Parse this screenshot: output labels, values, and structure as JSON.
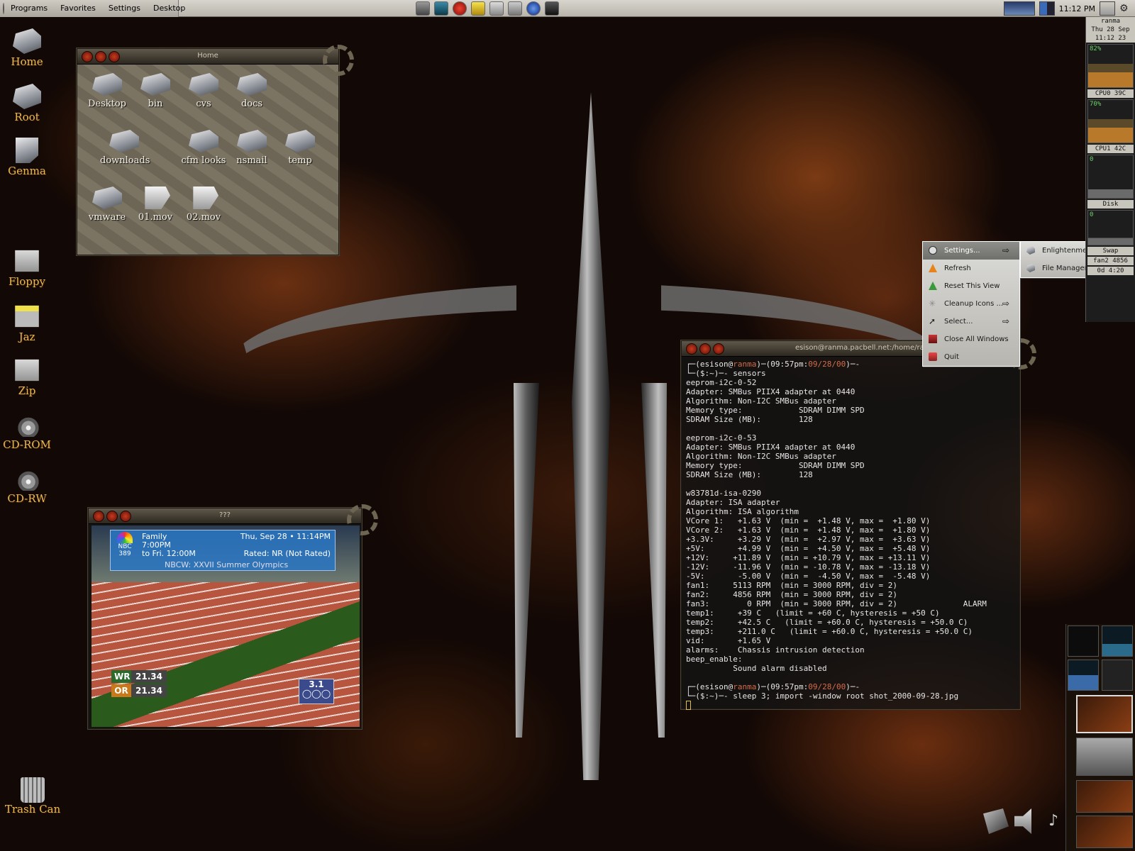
{
  "top_panel": {
    "menus": [
      "Programs",
      "Favorites",
      "Settings",
      "Desktop"
    ],
    "clock": "11:12 PM"
  },
  "desktop_icons": [
    "Home",
    "Root",
    "Genma",
    "Floppy",
    "Jaz",
    "Zip",
    "CD-ROM",
    "CD-RW"
  ],
  "trash_label": "Trash Can",
  "home_window": {
    "title": "Home",
    "files": [
      "Desktop",
      "bin",
      "cvs",
      "docs",
      "downloads",
      "cfm looks",
      "nsmail",
      "temp",
      "vmware",
      "01.mov",
      "02.mov"
    ]
  },
  "video_window": {
    "title": "???",
    "guide": {
      "channel": "NBC",
      "channel_num": "389",
      "genre": "Family",
      "time": "7:00PM",
      "until": "to Fri. 12:00M",
      "date": "Thu, Sep 28 • 11:14PM",
      "rated": "Rated: NR (Not Rated)",
      "show": "NBCW: XXVII Summer Olympics"
    },
    "scores": [
      {
        "tag": "WR",
        "value": "21.34"
      },
      {
        "tag": "OR",
        "value": "21.34"
      }
    ],
    "heat": "3.1"
  },
  "terminal": {
    "title": "esison@ranma.pacbell.net:/home/ranma/esison",
    "user": "esison",
    "host": "ranma",
    "time": "09:57pm",
    "date": "09/28/00",
    "cmd1": "sensors",
    "output": [
      "eeprom-i2c-0-52",
      "Adapter: SMBus PIIX4 adapter at 0440",
      "Algorithm: Non-I2C SMBus adapter",
      "Memory type:            SDRAM DIMM SPD",
      "SDRAM Size (MB):        128",
      "",
      "eeprom-i2c-0-53",
      "Adapter: SMBus PIIX4 adapter at 0440",
      "Algorithm: Non-I2C SMBus adapter",
      "Memory type:            SDRAM DIMM SPD",
      "SDRAM Size (MB):        128",
      "",
      "w83781d-isa-0290",
      "Adapter: ISA adapter",
      "Algorithm: ISA algorithm",
      "VCore 1:   +1.63 V  (min =  +1.48 V, max =  +1.80 V)",
      "VCore 2:   +1.63 V  (min =  +1.48 V, max =  +1.80 V)",
      "+3.3V:     +3.29 V  (min =  +2.97 V, max =  +3.63 V)",
      "+5V:       +4.99 V  (min =  +4.50 V, max =  +5.48 V)",
      "+12V:     +11.89 V  (min = +10.79 V, max = +13.11 V)",
      "-12V:     -11.96 V  (min = -10.78 V, max = -13.18 V)",
      "-5V:       -5.00 V  (min =  -4.50 V, max =  -5.48 V)",
      "fan1:     5113 RPM  (min = 3000 RPM, div = 2)",
      "fan2:     4856 RPM  (min = 3000 RPM, div = 2)",
      "fan3:        0 RPM  (min = 3000 RPM, div = 2)              ALARM",
      "temp1:     +39 C   (limit = +60 C, hysteresis = +50 C)",
      "temp2:     +42.5 C   (limit = +60.0 C, hysteresis = +50.0 C)",
      "temp3:     +211.0 C   (limit = +60.0 C, hysteresis = +50.0 C)",
      "vid:       +1.65 V",
      "alarms:    Chassis intrusion detection",
      "beep_enable:",
      "          Sound alarm disabled",
      ""
    ],
    "cmd2": "sleep 3; import -window root shot_2000-09-28.jpg"
  },
  "context_menu": {
    "items": [
      "Settings...",
      "Refresh",
      "Reset This View",
      "Cleanup Icons ...",
      "Select...",
      "Close All Windows",
      "Quit"
    ]
  },
  "submenu": {
    "items": [
      "Enlightenment",
      "File Manager"
    ]
  },
  "monitor": {
    "host": "ranma",
    "date": "Thu 28 Sep",
    "time": "11:12 23",
    "cpu0_pct": "82%",
    "cpu0_label": "CPU0",
    "cpu0_temp": "39C",
    "cpu1_pct": "70%",
    "cpu1_label": "CPU1",
    "cpu1_temp": "42C",
    "disk_label": "Disk",
    "disk_val": "0",
    "mem_val": "0",
    "swap_label": "Swap",
    "fan_label": "fan2 4856",
    "uptime": "0d 4:20"
  },
  "colors": {
    "icon_label": "#e8b850",
    "prompt_user": "#d26b4a",
    "menu_bg": "#c9c7c2"
  }
}
